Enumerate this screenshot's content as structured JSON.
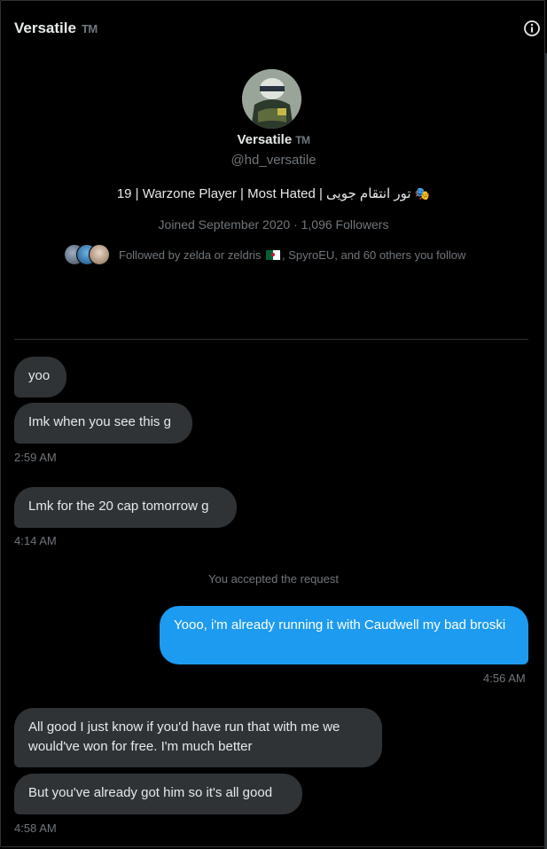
{
  "header": {
    "name": "Versatile",
    "suffix": "TM",
    "info_icon": "info-circle-icon"
  },
  "profile": {
    "avatar_icon": "profile-avatar",
    "name": "Versatile",
    "suffix": "TM",
    "handle": "@hd_versatile",
    "bio_text": "19 | Warzone Player | Most Hated | تور انتقام جویی",
    "bio_emoji": "🎭",
    "joined": "Joined September 2020 · 1,096 Followers",
    "followed_by_prefix": "Followed by zelda or zeldris",
    "followed_by_suffix": ", SpyroEU, and 60 others you follow"
  },
  "conversation": {
    "messages": [
      {
        "text": "yoo"
      },
      {
        "text": "Imk when you see this g"
      },
      {
        "time": "2:59 AM"
      },
      {
        "text": "Lmk for the 20 cap tomorrow g"
      },
      {
        "time": "4:14 AM"
      },
      {
        "system": "You accepted the request"
      },
      {
        "text": "Yooo, i'm already running it with Caudwell my bad broski"
      },
      {
        "time": "4:56 AM"
      },
      {
        "text": "All good I just know if you'd have run that with me we would've won for free. I'm much better"
      },
      {
        "text": "But you've already got him so it's all good"
      },
      {
        "time": "4:58 AM"
      }
    ]
  },
  "colors": {
    "background": "#000000",
    "incoming_bubble": "#2f3336",
    "outgoing_bubble": "#1d9bf0",
    "muted_text": "#71767b"
  }
}
